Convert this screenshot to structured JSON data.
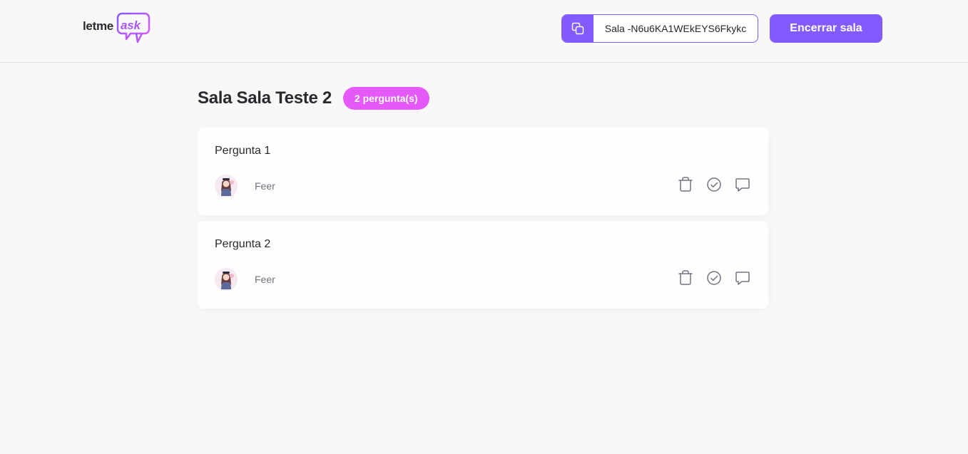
{
  "header": {
    "logo": {
      "prefix": "letme",
      "suffix": "ask"
    },
    "room_code": {
      "label": "Sala -N6u6KA1WEkEYS6Fkykc",
      "icon": "copy-icon"
    },
    "close_button_label": "Encerrar sala"
  },
  "room": {
    "title": "Sala Sala Teste 2",
    "question_count_label": "2 pergunta(s)"
  },
  "questions": [
    {
      "content": "Pergunta 1",
      "author": "Feer",
      "actions": [
        "trash-icon",
        "check-circle-icon",
        "answer-icon"
      ]
    },
    {
      "content": "Pergunta 2",
      "author": "Feer",
      "actions": [
        "trash-icon",
        "check-circle-icon",
        "answer-icon"
      ]
    }
  ],
  "colors": {
    "primary": "#835afd",
    "badge": "#e559f9",
    "logo_accent": "#a855f7",
    "background": "#f8f8f8",
    "icon_gray": "#737380"
  }
}
